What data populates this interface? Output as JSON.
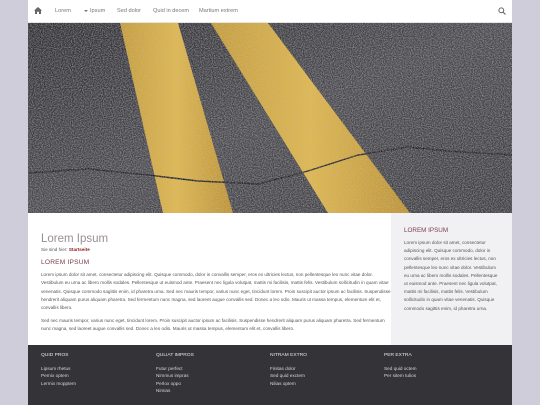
{
  "nav": {
    "items": [
      "Lorem",
      "Ipsum",
      "Sed dolor",
      "Quid in decem",
      "Martium extrem"
    ]
  },
  "main": {
    "title": "Lorem Ipsum",
    "breadcrumb_prefix": "Sie sind hier:",
    "breadcrumb_current": "Startseite",
    "heading": "LOREM IPSUM",
    "paragraph1": "Lorem ipsum dolor sit amet, consectetur adipiscing elit. Quisque commodo, dolor in convallis semper, eros ex ultricies lectus, non pellentesque leo nunc vitae dolor. Vestibulum eu urna ac libero mollis sodales. Pellentesque ut euismod ante. Praesent nec ligula volutpat, mattis mi facilisis, mattis felis. Vestibulum sollicitudin in quam vitae venenatis. Quisque commodo sagittis enim, id pharetra urna. Sed nec mauris tempor, varius nunc eget, tincidunt lorem. Proin suscipit auctor ipsum ac facilisis. Suspendisse hendrerit aliquam purus aliquam pharetra. Sed fermentum nunc magna, sed laoreet augue convallis sed. Donec a leo odio. Mauris ut massa tempus, elementum elit et, convallis libero.",
    "paragraph2": "Sed nec mauris tempor, varius nunc eget, tincidunt lorem. Proin suscipit auctor ipsum ac facilisis. Suspendisse hendrerit aliquam purus aliquam pharetra. Sed fermentum nunc magna, sed laoreet augue convallis sed. Donec a leo odio. Mauris ut massa tempus, elementum elit et, convallis libero."
  },
  "sidebar": {
    "heading": "LOREM IPSUM",
    "text": "Lorem ipsum dolor sit amet, consectetur adipiscing elit. Quisque commodo, dolor in convallis semper, eros ex ultricies lectus, non pellentesque leo nunc vitae dolor. Vestibulum eu urna ac libero mollis sodales. Pellentesque ut euismod ante. Praesent nec ligula volutpat, mattis mi facilisis, mattis felis. Vestibulum sollicitudin in quam vitae venenatis. Quisque commodo sagittis enim, id pharetra urna."
  },
  "footer": {
    "columns": [
      {
        "heading": "QUID PROS",
        "links": [
          "Lipsum rhetus",
          "Pernix optem",
          "Lermix mopptem"
        ]
      },
      {
        "heading": "QULIAT IMPROS",
        "links": [
          "Futur perfect",
          "Nimmus impras",
          "Perlox oppo",
          "Nimias"
        ]
      },
      {
        "heading": "NITRAM EXTRO",
        "links": [
          "Finitas dolor",
          "Sed quid exctem",
          "Nilias optem"
        ]
      },
      {
        "heading": "PER EXTRA",
        "links": [
          "Sed quid octem",
          "Per sitem tulios"
        ]
      }
    ]
  },
  "colors": {
    "accent": "#8b1a1a",
    "heading": "#7a3f4a",
    "footer_bg": "#333338",
    "side_bg": "#cfcdd9"
  },
  "icons": {
    "home": "home-icon",
    "search": "search-icon",
    "dropdown": "chevron-down-icon"
  }
}
